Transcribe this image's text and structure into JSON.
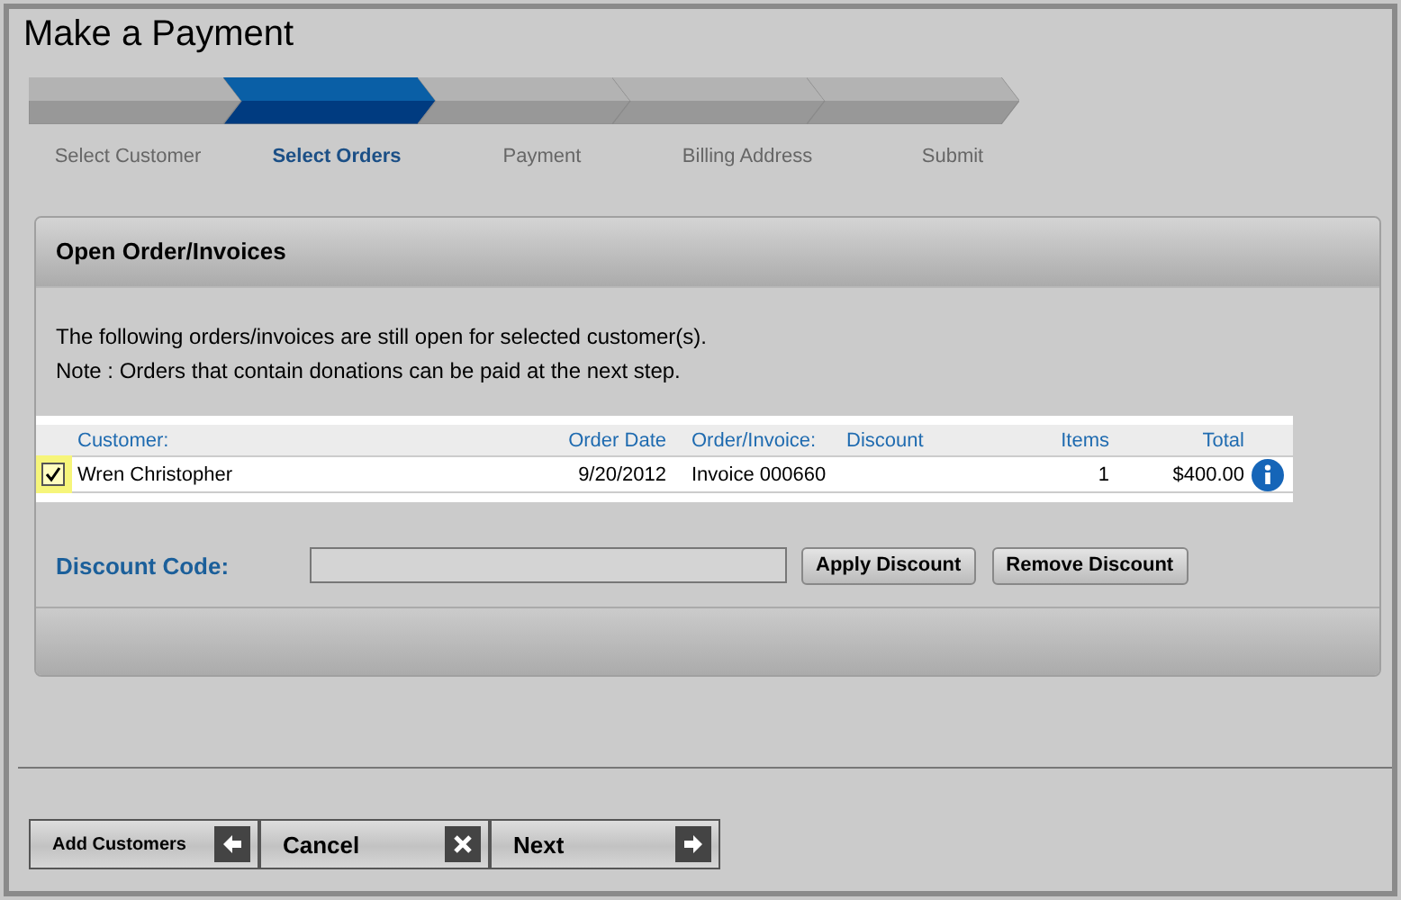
{
  "page": {
    "title": "Make a Payment"
  },
  "steps": [
    {
      "label": "Select Customer",
      "selected": false
    },
    {
      "label": "Select Orders",
      "selected": true
    },
    {
      "label": "Payment",
      "selected": false
    },
    {
      "label": "Billing Address",
      "selected": false
    },
    {
      "label": "Submit",
      "selected": false
    }
  ],
  "panel": {
    "title": "Open Order/Invoices",
    "lines": [
      "The following orders/invoices are still open for selected customer(s).",
      "Note : Orders that contain donations can be paid at the next step."
    ]
  },
  "table": {
    "columns": [
      "Customer:",
      "Order Date",
      "Order/Invoice:",
      "Discount",
      "Items",
      "Total"
    ],
    "rows": [
      {
        "checked": true,
        "cells": [
          "Wren Christopher",
          "9/20/2012",
          "Invoice 000660",
          "",
          "1",
          "$400.00"
        ]
      }
    ]
  },
  "discount": {
    "label": "Discount Code:",
    "buttons": [
      "Apply Discount",
      "Remove Discount"
    ]
  },
  "footer_buttons": [
    {
      "label": "Add Customers",
      "kind": "back"
    },
    {
      "label": "Cancel",
      "kind": "cancel"
    },
    {
      "label": "Next",
      "kind": "next"
    }
  ]
}
